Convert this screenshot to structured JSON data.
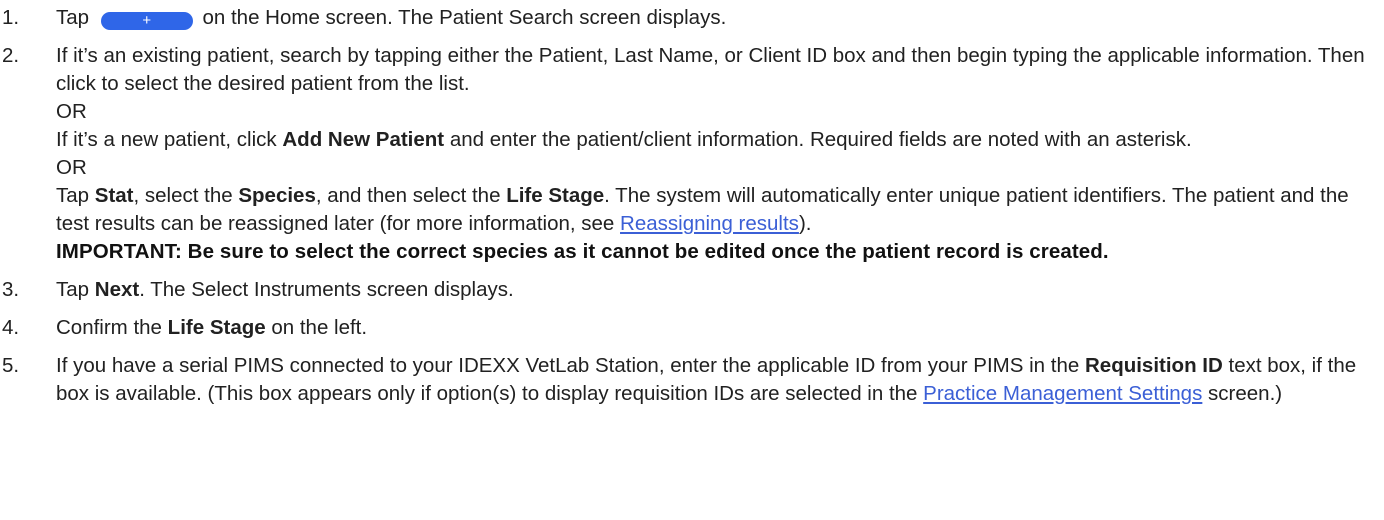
{
  "steps": [
    {
      "number": "1.",
      "a": "Tap",
      "button_glyph": "+",
      "b": "on the Home screen. The Patient Search screen displays."
    },
    {
      "number": "2.",
      "p1": "If it’s an existing patient, search by tapping either the Patient, Last Name, or Client ID box and then begin typing the applicable information. Then click to select the desired patient from the list.",
      "or1": "OR",
      "p2_a": "If it’s a new patient, click",
      "p2_bold": "Add New Patient",
      "p2_b": "and enter the patient/client information. Required fields are noted with an asterisk.",
      "or2": "OR",
      "p3_a": "Tap",
      "p3_bold1": "Stat",
      "p3_b": ", select the",
      "p3_bold2": "Species",
      "p3_c": ", and then select the",
      "p3_bold3": "Life Stage",
      "p3_d": ". The system will automatically enter unique patient identifiers. The patient and the test results can be reassigned later (for more information, see",
      "p3_link": "Reassigning results",
      "p3_e": ").",
      "important": "IMPORTANT: Be sure to select the correct species as it cannot be edited once the patient record is created."
    },
    {
      "number": "3.",
      "a": "Tap",
      "bold": "Next",
      "b": ". The Select Instruments screen displays."
    },
    {
      "number": "4.",
      "a": "Confirm the",
      "bold": "Life Stage",
      "b": "on the left."
    },
    {
      "number": "5.",
      "a": "If you have a serial PIMS connected to your IDEXX VetLab Station, enter the applicable ID from your PIMS in the",
      "bold": "Requisition ID",
      "b": "text box, if the box is available. (This box appears only if option(s) to display requisition IDs are selected in the",
      "link": "Practice Management Settings",
      "c": "screen.)"
    }
  ],
  "colors": {
    "text": "#212121",
    "link": "#3b5fd6",
    "button": "#2f66e8"
  },
  "icons": {
    "new_test_button": "plus-icon"
  }
}
